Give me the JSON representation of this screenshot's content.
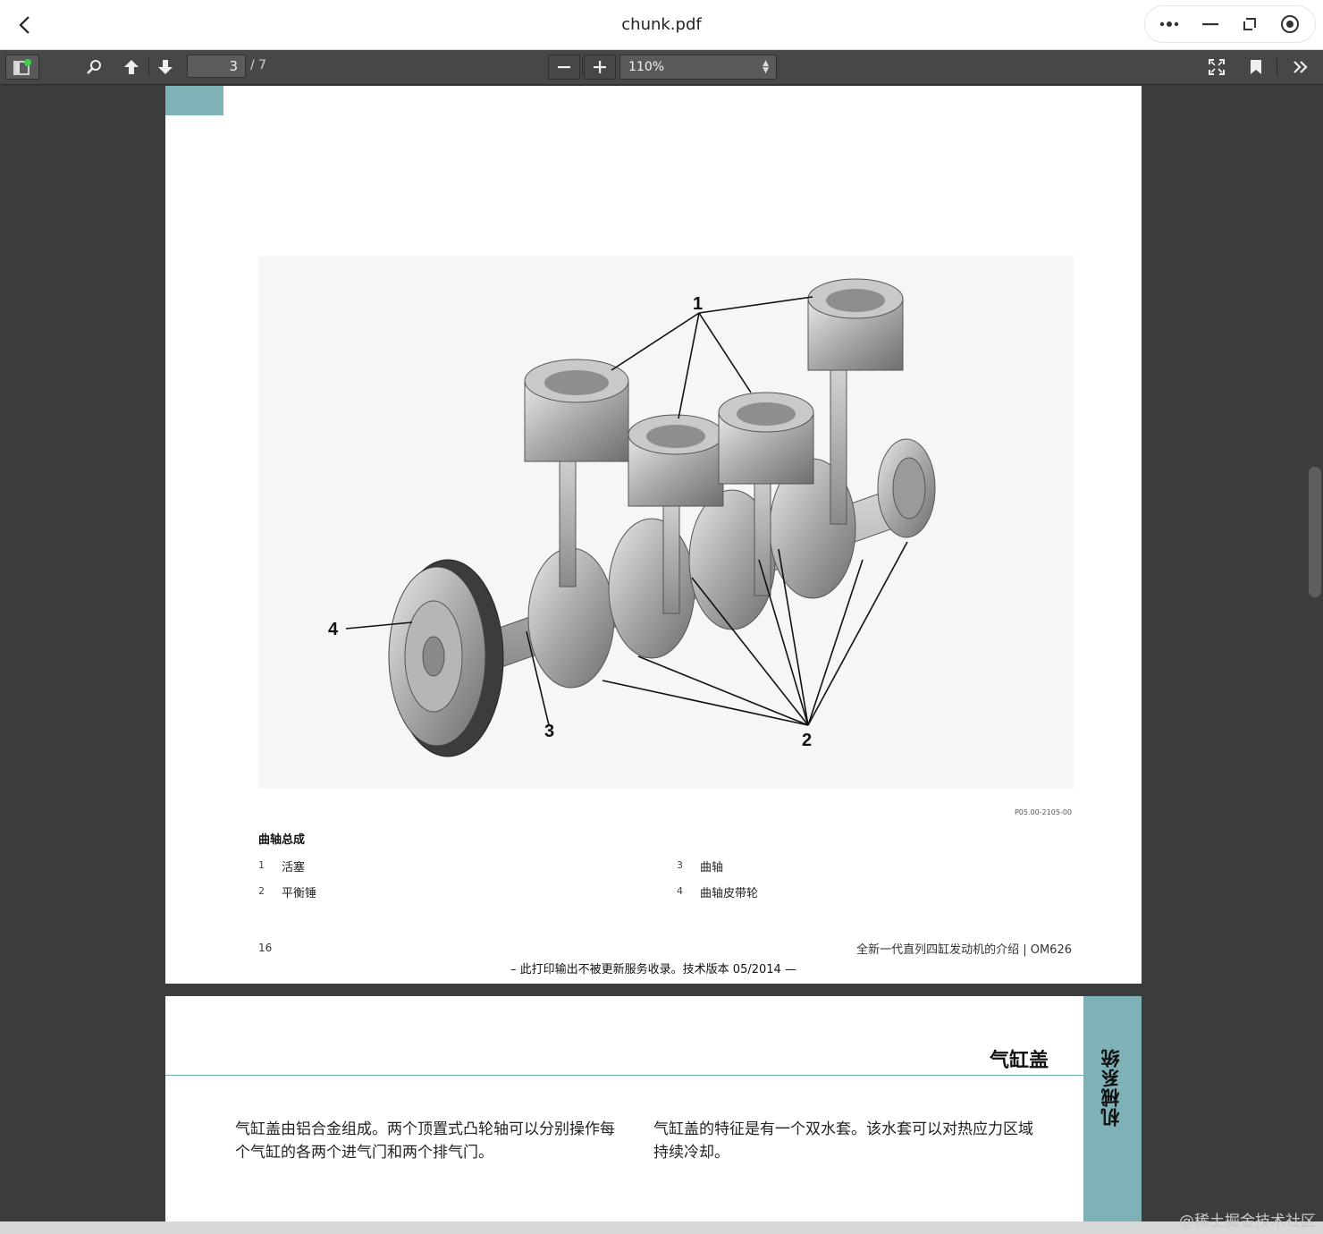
{
  "window": {
    "title": "chunk.pdf"
  },
  "toolbar": {
    "page_current": "3",
    "page_total": "/ 7",
    "zoom": "110%"
  },
  "page1": {
    "figure": {
      "callouts": [
        "1",
        "2",
        "3",
        "4"
      ],
      "code": "P05.00-2105-00"
    },
    "caption": "曲轴总成",
    "legend": [
      {
        "num": "1",
        "label": "活塞"
      },
      {
        "num": "2",
        "label": "平衡锤"
      },
      {
        "num": "3",
        "label": "曲轴"
      },
      {
        "num": "4",
        "label": "曲轴皮带轮"
      }
    ],
    "page_number": "16",
    "footer_title": "全新一代直列四缸发动机的介绍 | OM626",
    "print_note": "– 此打印输出不被更新服务收录。技术版本 05/2014 —"
  },
  "page2": {
    "section_title": "气缸盖",
    "side_tab": "机械系统",
    "para_left": "气缸盖由铝合金组成。两个顶置式凸轮轴可以分别操作每个气缸的各两个进气门和两个排气门。",
    "para_right": "气缸盖的特征是有一个双水套。该水套可以对热应力区域持续冷却。"
  },
  "watermark": "@稀土掘金技术社区",
  "colors": {
    "accent_teal": "#7fb2b7",
    "toolbar_bg": "#474747",
    "viewer_bg": "#3c3c3c"
  }
}
